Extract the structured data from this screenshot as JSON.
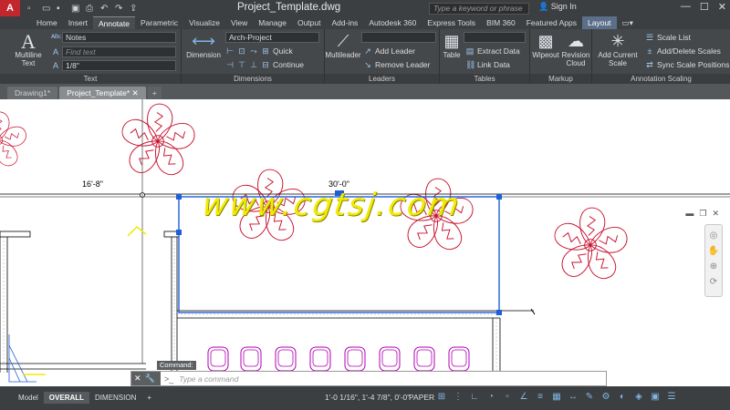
{
  "titlebar": {
    "app_letter": "A",
    "title": "Project_Template.dwg",
    "search_placeholder": "Type a keyword or phrase",
    "sign_in": "Sign In"
  },
  "ribbon_tabs": [
    "Home",
    "Insert",
    "Annotate",
    "Parametric",
    "Visualize",
    "View",
    "Manage",
    "Output",
    "Add-ins",
    "Autodesk 360",
    "Express Tools",
    "BIM 360",
    "Featured Apps",
    "Layout"
  ],
  "active_tab": "Annotate",
  "ribbon": {
    "text": {
      "title": "Text",
      "multiline_label": "Multiline Text",
      "style_value": "Notes",
      "find_placeholder": "Find text",
      "height_value": "1/8\""
    },
    "dimensions": {
      "title": "Dimensions",
      "dimension_label": "Dimension",
      "style_value": "Arch-Project",
      "quick_label": "Quick",
      "continue_label": "Continue"
    },
    "leaders": {
      "title": "Leaders",
      "multileader_label": "Multileader",
      "add_leader_label": "Add Leader",
      "remove_leader_label": "Remove Leader",
      "style_value": ""
    },
    "tables": {
      "title": "Tables",
      "table_label": "Table",
      "extract_label": "Extract Data",
      "link_label": "Link Data",
      "style_value": ""
    },
    "markup": {
      "title": "Markup",
      "wipeout_label": "Wipeout",
      "revision_label": "Revision Cloud"
    },
    "annotation_scaling": {
      "title": "Annotation Scaling",
      "add_scale_label": "Add Current Scale",
      "scale_list_label": "Scale List",
      "add_delete_label": "Add/Delete Scales",
      "sync_label": "Sync Scale Positions"
    }
  },
  "doc_tabs": [
    {
      "label": "Drawing1*",
      "active": false
    },
    {
      "label": "Project_Template*",
      "active": true
    }
  ],
  "canvas": {
    "dim_left": "16'-8\"",
    "dim_right": "30'-0\"",
    "watermark": "www.cgtsj.com"
  },
  "command": {
    "label": "Command:",
    "placeholder": "Type a command"
  },
  "status": {
    "layouts": [
      "Model",
      "OVERALL",
      "DIMENSION"
    ],
    "active_layout": "OVERALL",
    "coords": "1'-0 1/16\", 1'-4 7/8\", 0'-0\"",
    "space": "PAPER"
  },
  "colors": {
    "flowers": "#c8102e",
    "chairs": "#b000b0",
    "selection": "#1e5fd6",
    "walls": "#000000",
    "watermark": "#f2ea00"
  }
}
